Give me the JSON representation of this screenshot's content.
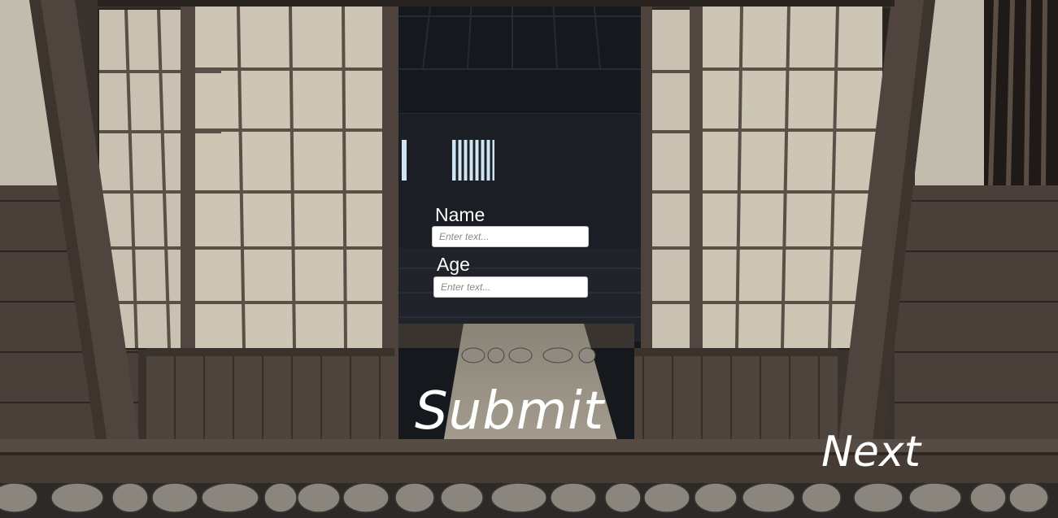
{
  "form": {
    "name_label": "Name",
    "name_placeholder": "Enter text...",
    "age_label": "Age",
    "age_placeholder": "Enter text...",
    "submit_label": "Submit"
  },
  "navigation": {
    "next_label": "Next"
  },
  "colors": {
    "ui_text": "#ffffff",
    "input_bg": "#ffffff",
    "placeholder": "#8a8a8a",
    "wood": "#4a3e35",
    "shoji_paper": "#cfc8b8",
    "interior": "#16191e"
  }
}
